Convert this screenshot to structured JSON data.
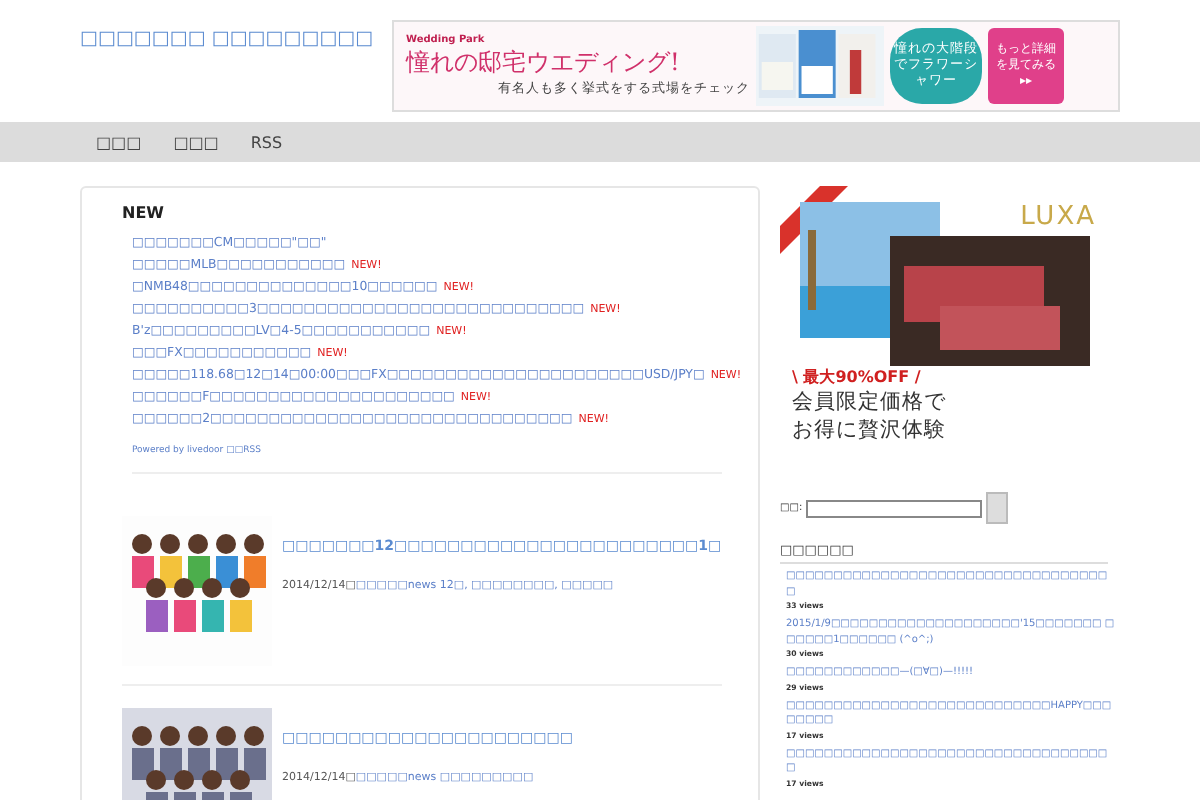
{
  "header": {
    "title": "□□□□□□□ □□□□□□□□□",
    "banner": {
      "brand": "Wedding Park",
      "headline": "憧れの邸宅ウエディング!",
      "subline": "有名人も多く挙式をする式場をチェック",
      "badge": "憧れの大階段でフラワーシャワー",
      "button": "もっと詳細を見てみる ▸▸"
    }
  },
  "nav": [
    {
      "label": "□□□"
    },
    {
      "label": "□□□"
    },
    {
      "label": "RSS"
    }
  ],
  "news": {
    "heading": "NEW",
    "items": [
      {
        "text": "□□□□□□□CM□□□□□\"□□\""
      },
      {
        "text": "□□□□□MLB□□□□□□□□□□□",
        "badge": "NEW!"
      },
      {
        "text": "□NMB48□□□□□□□□□□□□□□10□□□□□□",
        "badge": "NEW!"
      },
      {
        "text": "□□□□□□□□□□3□□□□□□□□□□□□□□□□□□□□□□□□□□□□",
        "badge": "NEW!"
      },
      {
        "text": "B'z□□□□□□□□□LV□4-5□□□□□□□□□□□",
        "badge": "NEW!"
      },
      {
        "text": "□□□FX□□□□□□□□□□□",
        "badge": "NEW!"
      },
      {
        "text": "□□□□□118.68□12□14□00:00□□□FX□□□□□□□□□□□□□□□□□□□□□□USD/JPY□",
        "badge": "NEW!"
      },
      {
        "text": "□□□□□□F□□□□□□□□□□□□□□□□□□□□□",
        "badge": "NEW!"
      },
      {
        "text": "□□□□□□2□□□□□□□□□□□□□□□□□□□□□□□□□□□□□□□",
        "badge": "NEW!"
      }
    ],
    "powered": "Powered by livedoor □□RSS"
  },
  "posts": [
    {
      "title": "□□□□□□□12□□□□□□□□□□□□□□□□□□□□□□□1□",
      "date": "2014/12/14□",
      "categories": "□□□□□news 12□, □□□□□□□□, □□□□□"
    },
    {
      "title": "□□□□□□□□□□□□□□□□□□□□□□",
      "date": "2014/12/14□",
      "categories": "□□□□□news □□□□□□□□□"
    }
  ],
  "sidebar": {
    "ad": {
      "brand": "LUXA",
      "offer": "\\ 最大90%OFF /",
      "line1": "会員限定価格で",
      "line2": "お得に贅沢体験"
    },
    "search": {
      "label": "□□:"
    },
    "popular": {
      "heading": "□□□□□□",
      "items": [
        {
          "title": "□□□□□□□□□□□□□□□□□□□□□□□□□□□□□□□□□□□",
          "views": "33 views"
        },
        {
          "title": "2015/1/9□□□□□□□□□□□□□□□□□□□□'15□□□□□□□ □□□□□□1□□□□□□ (^o^;)",
          "views": "30 views"
        },
        {
          "title": "□□□□□□□□□□□□—(□∀□)—!!!!!",
          "views": "29 views"
        },
        {
          "title": "□□□□□□□□□□□□□□□□□□□□□□□□□□□□HAPPY□□□□□□□□",
          "views": "17 views"
        },
        {
          "title": "□□□□□□□□□□□□□□□□□□□□□□□□□□□□□□□□□□□",
          "views": "17 views"
        }
      ]
    }
  }
}
